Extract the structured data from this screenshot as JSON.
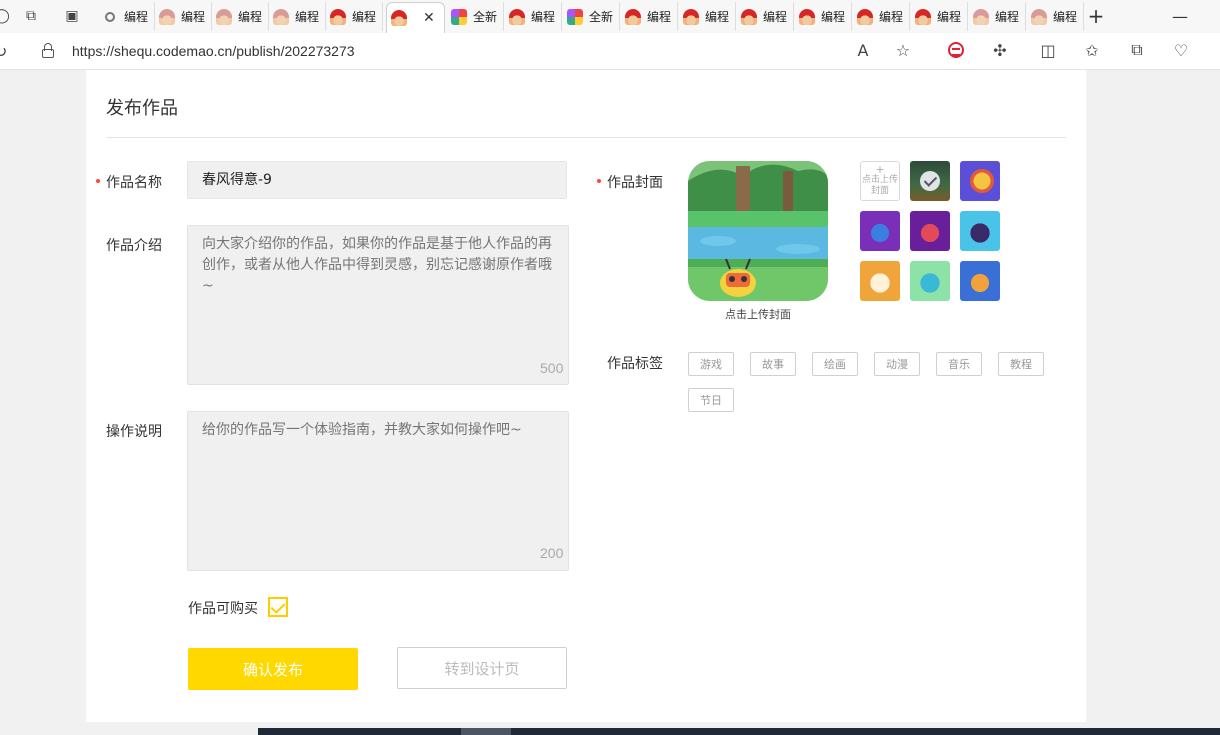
{
  "browser": {
    "tabs": [
      {
        "label": "",
        "favicon": "search-icon"
      },
      {
        "label": "编程",
        "favicon": "codemao-pale-icon"
      },
      {
        "label": "编程",
        "favicon": "codemao-pale-icon"
      },
      {
        "label": "编程",
        "favicon": "codemao-pale-icon"
      },
      {
        "label": "编程",
        "favicon": "codemao-icon"
      },
      {
        "label": "",
        "favicon": "codemao-icon",
        "active": true
      },
      {
        "label": "全新",
        "favicon": "new-icon"
      },
      {
        "label": "编程",
        "favicon": "codemao-icon"
      },
      {
        "label": "全新",
        "favicon": "new-icon"
      },
      {
        "label": "编程",
        "favicon": "codemao-icon"
      },
      {
        "label": "编程",
        "favicon": "codemao-icon"
      },
      {
        "label": "编程",
        "favicon": "codemao-icon"
      },
      {
        "label": "编程",
        "favicon": "codemao-icon"
      },
      {
        "label": "编程",
        "favicon": "codemao-icon"
      },
      {
        "label": "编程",
        "favicon": "codemao-icon"
      },
      {
        "label": "编程",
        "favicon": "codemao-pale-icon"
      },
      {
        "label": "编程",
        "favicon": "codemao-pale-icon"
      }
    ],
    "url": "https://shequ.codemao.cn/publish/202273273"
  },
  "form": {
    "title": "发布作品",
    "name_label": "作品名称",
    "name_value": "春风得意-9",
    "intro_label": "作品介绍",
    "intro_placeholder": "向大家介绍你的作品，如果你的作品是基于他人作品的再创作，或者从他人作品中得到灵感，别忘记感谢原作者哦~",
    "intro_counter": "500",
    "guide_label": "操作说明",
    "guide_placeholder": "给你的作品写一个体验指南，并教大家如何操作吧~",
    "guide_counter": "200",
    "purchasable_label": "作品可购买",
    "purchasable_checked": true,
    "publish_button": "确认发布",
    "design_button": "转到设计页"
  },
  "cover": {
    "label": "作品封面",
    "caption": "点击上传封面",
    "upload_text": "点击上传封面",
    "upload_plus": "+"
  },
  "tags": {
    "label": "作品标签",
    "items": [
      "游戏",
      "故事",
      "绘画",
      "动漫",
      "音乐",
      "教程",
      "节日"
    ]
  },
  "colors": {
    "accent": "#ffd800",
    "required_dot": "#ff4444",
    "card_bg": "#ffffff",
    "input_bg": "#f0f0f0"
  }
}
